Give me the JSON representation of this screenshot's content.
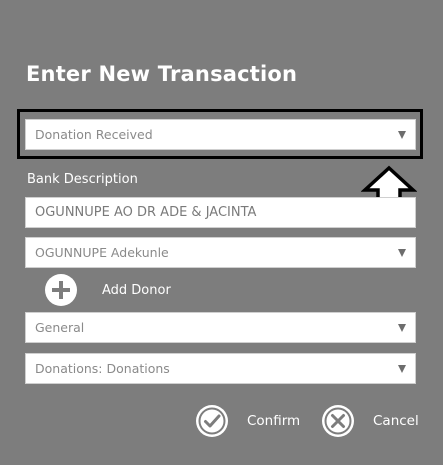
{
  "dialog": {
    "title": "Enter New Transaction"
  },
  "form": {
    "transaction_type": {
      "value": "Donation Received"
    },
    "bank_description": {
      "label": "Bank Description",
      "value": "OGUNNUPE AO DR ADE & JACINTA"
    },
    "donor": {
      "value": "OGUNNUPE Adekunle"
    },
    "add_donor_label": "Add Donor",
    "fund": {
      "value": "General"
    },
    "account": {
      "value": "Donations: Donations"
    }
  },
  "actions": {
    "confirm_label": "Confirm",
    "cancel_label": "Cancel"
  },
  "colors": {
    "background": "#7d7d7d",
    "field_background": "#ffffff",
    "field_text": "#8a8a8a",
    "text_light": "#ffffff",
    "highlight_border": "#000000"
  },
  "icons": {
    "highlight_arrow": "arrow-up-icon",
    "add_donor": "plus-circle-icon",
    "confirm": "check-circle-icon",
    "cancel": "x-circle-icon",
    "dropdown": "chevron-down-icon"
  }
}
